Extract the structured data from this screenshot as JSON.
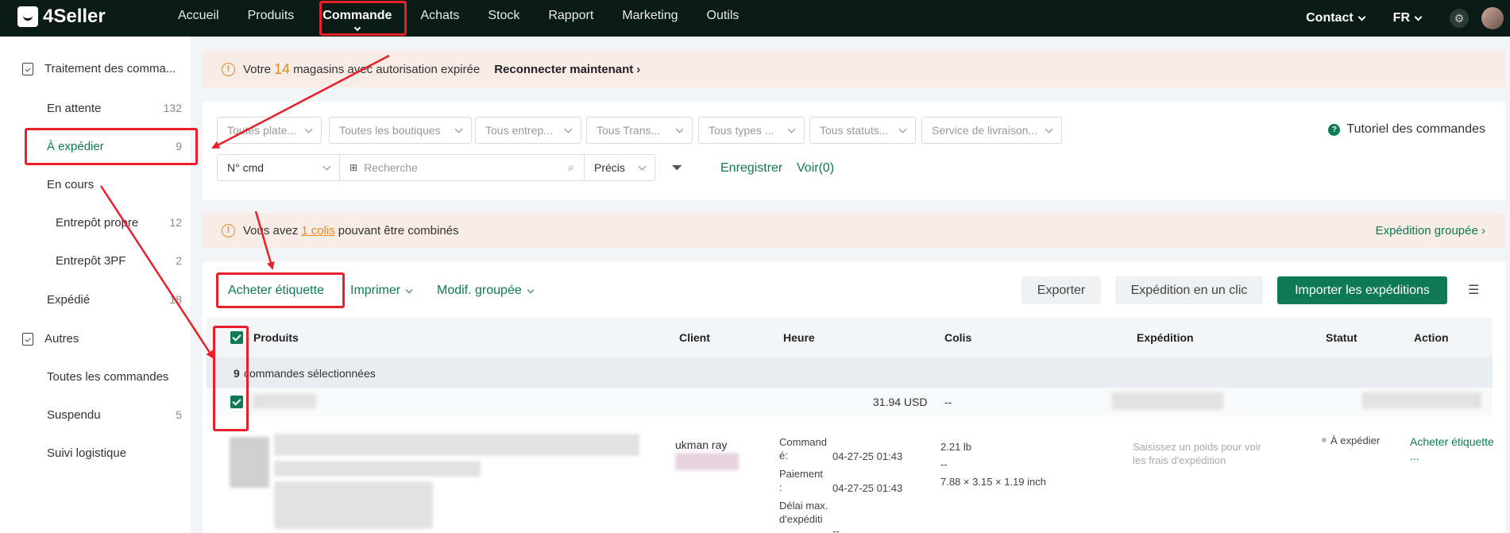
{
  "nav": {
    "brand": "4Seller",
    "items": [
      "Accueil",
      "Produits",
      "Commande",
      "Achats",
      "Stock",
      "Rapport",
      "Marketing",
      "Outils"
    ],
    "active": "Commande",
    "contact": "Contact",
    "language": "FR"
  },
  "sidebar": {
    "section1": "Traitement des comma...",
    "items": [
      {
        "label": "En attente",
        "count": "132"
      },
      {
        "label": "À expédier",
        "count": "9"
      },
      {
        "label": "En cours",
        "count": ""
      },
      {
        "label": "Entrepôt propre",
        "count": "12"
      },
      {
        "label": "Entrepôt 3PF",
        "count": "2"
      },
      {
        "label": "Expédié",
        "count": "18"
      }
    ],
    "section2": "Autres",
    "others": [
      {
        "label": "Toutes les commandes",
        "count": ""
      },
      {
        "label": "Suspendu",
        "count": "5"
      },
      {
        "label": "Suivi logistique",
        "count": ""
      }
    ]
  },
  "alert1": {
    "prefix": "Votre",
    "count": "14",
    "suffix": "magasins avec autorisation expirée",
    "action": "Reconnecter maintenant"
  },
  "filters": {
    "dropdowns": [
      "Toutes plate...",
      "Toutes les boutiques",
      "Tous entrep...",
      "Tous Trans...",
      "Tous types ...",
      "Tous statuts...",
      "Service de livraison..."
    ],
    "search_type": "N° cmd",
    "search_placeholder": "Recherche",
    "match": "Précis",
    "save": "Enregistrer",
    "view": "Voir(0)",
    "tutorial": "Tutoriel des commandes"
  },
  "alert2": {
    "prefix": "Vous avez",
    "link": "1 colis",
    "suffix": "pouvant être combinés",
    "action": "Expédition groupée"
  },
  "toolbar": {
    "buy_label": "Acheter étiquette",
    "print": "Imprimer",
    "bulk_edit": "Modif. groupée",
    "export": "Exporter",
    "one_click": "Expédition en un clic",
    "import": "Importer les expéditions"
  },
  "table": {
    "headers": [
      "Produits",
      "Client",
      "Heure",
      "Colis",
      "Expédition",
      "Statut",
      "Action"
    ],
    "selected_count": "9",
    "selected_text": "commandes sélectionnées",
    "order": {
      "amount": "31.94 USD",
      "colis_dash": "--",
      "client_partial": "ukman ray",
      "time_labels": [
        "Command é:",
        "Paiement :",
        "Délai max. d'expéditi on:"
      ],
      "commande_time": "04-27-25 01:43",
      "paiement_time": "04-27-25 01:43",
      "delai_time": "--",
      "weight": "2.21 lb",
      "weight_dash": "--",
      "dims": "7.88 × 3.15 × 1.19 inch",
      "shipping_hint": "Saisissez un poids pour voir les frais d'expédition",
      "status": "À expédier",
      "action": "Acheter étiquette",
      "more": "..."
    }
  },
  "colors": {
    "accent": "#0d7a55",
    "highlight": "#e8202a",
    "warn": "#e88a24"
  }
}
